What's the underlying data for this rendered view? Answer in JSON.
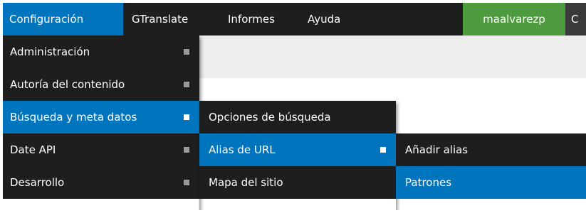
{
  "topbar": {
    "items": [
      {
        "label": "Configuración"
      },
      {
        "label": "GTranslate"
      },
      {
        "label": "Informes"
      },
      {
        "label": "Ayuda"
      }
    ],
    "user": "maalvarezp",
    "more": "C"
  },
  "menu_level1": [
    {
      "label": "Administración"
    },
    {
      "label": "Autoría del contenido"
    },
    {
      "label": "Búsqueda y meta datos"
    },
    {
      "label": "Date API"
    },
    {
      "label": "Desarrollo"
    }
  ],
  "menu_level2": [
    {
      "label": "Opciones de búsqueda"
    },
    {
      "label": "Alias de URL"
    },
    {
      "label": "Mapa del sitio"
    }
  ],
  "menu_level3": [
    {
      "label": "Añadir alias"
    },
    {
      "label": "Patrones"
    }
  ],
  "colors": {
    "bar": "#1e1e1e",
    "active": "#0074bd",
    "user": "#4e9a3e"
  }
}
